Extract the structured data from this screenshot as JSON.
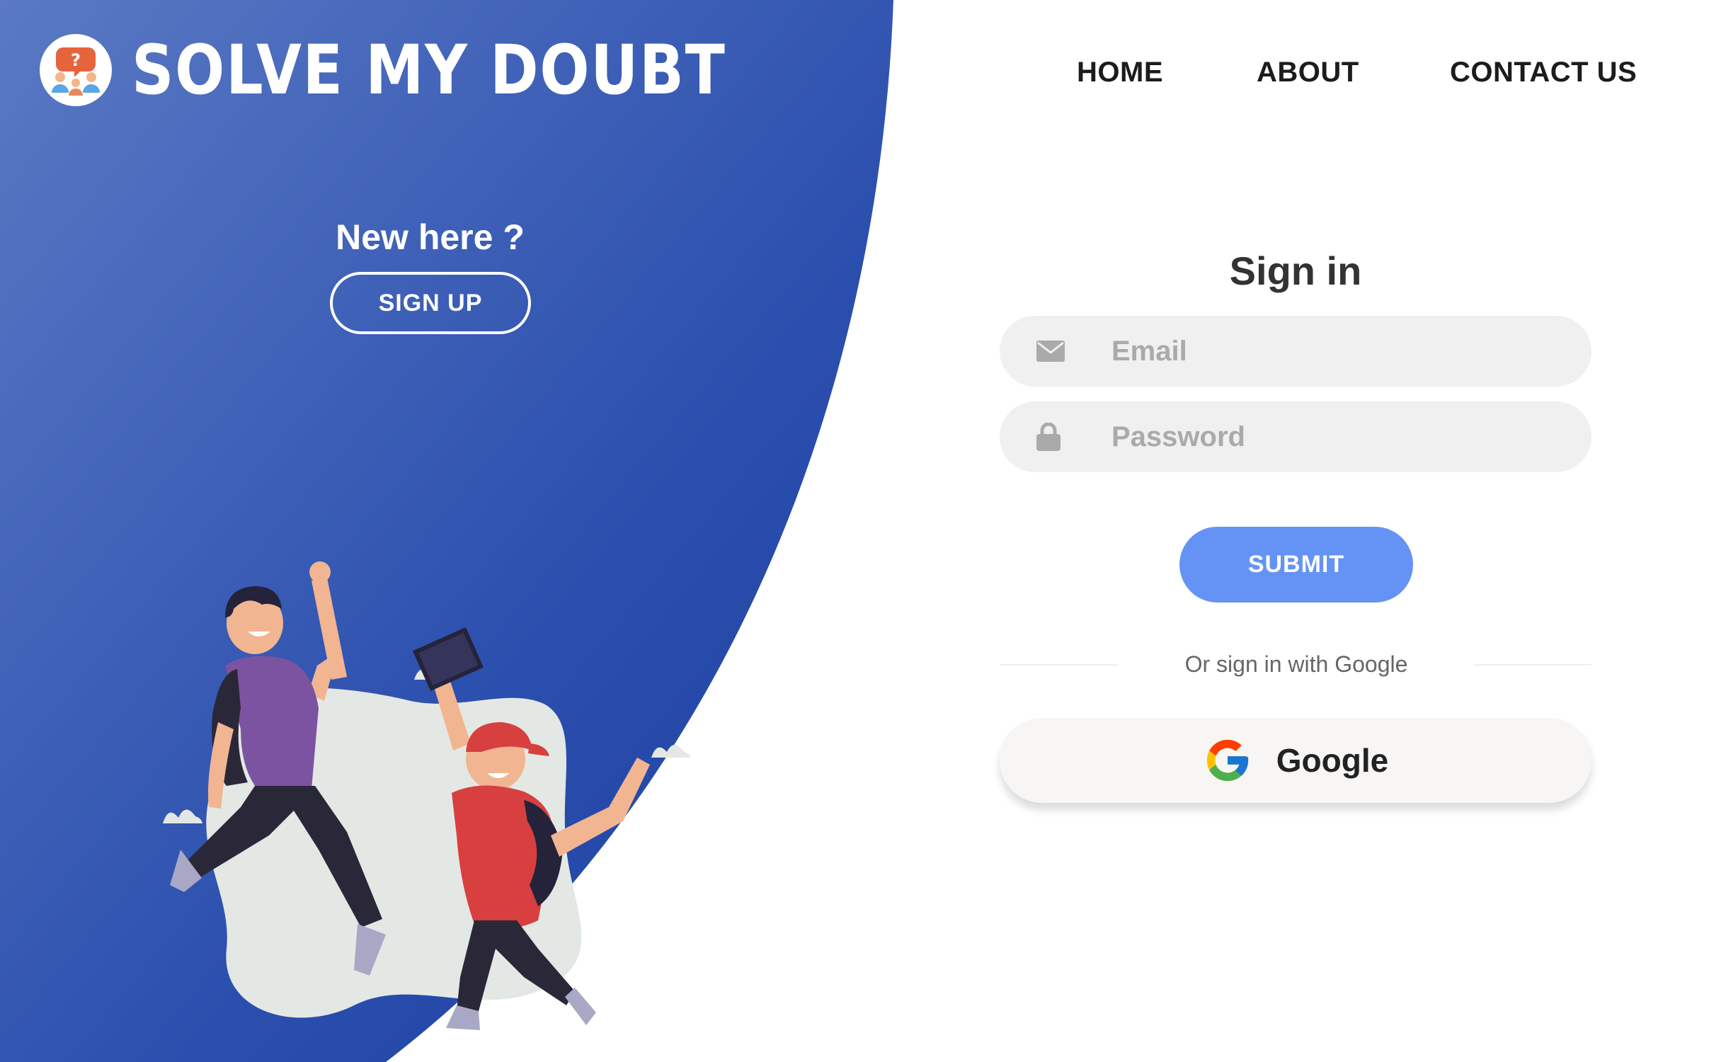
{
  "brand": {
    "name": "SOLVE MY DOUBT",
    "logo_icon": "students-question-logo"
  },
  "nav": {
    "home": "HOME",
    "about": "ABOUT",
    "contact": "CONTACT US"
  },
  "left_panel": {
    "heading": "New here ?",
    "signup_label": "SIGN UP",
    "illustration": "two-students-jumping"
  },
  "signin": {
    "title": "Sign in",
    "email": {
      "placeholder": "Email",
      "value": "",
      "icon": "envelope-icon"
    },
    "password": {
      "placeholder": "Password",
      "value": "",
      "icon": "lock-icon"
    },
    "submit_label": "SUBMIT",
    "alt_text": "Or sign in with Google",
    "google_label": "Google"
  },
  "colors": {
    "panel_blue_light": "#5a79c4",
    "panel_blue_dark": "#1f43a5",
    "submit": "#6593f5",
    "field_bg": "#f0f0f0"
  }
}
